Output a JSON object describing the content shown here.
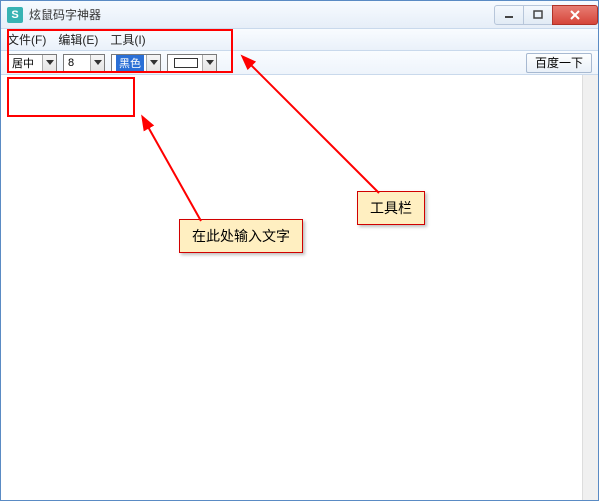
{
  "window": {
    "app_icon_letter": "S",
    "title": "炫鼠码字神器"
  },
  "menu": {
    "file": "文件(F)",
    "edit": "编辑(E)",
    "tool": "工具(I)"
  },
  "toolbar": {
    "align_value": "居中",
    "size_value": "8",
    "color_value": "黑色",
    "search_btn": "百度一下"
  },
  "annotations": {
    "toolbar_label": "工具栏",
    "input_label": "在此处输入文字"
  }
}
